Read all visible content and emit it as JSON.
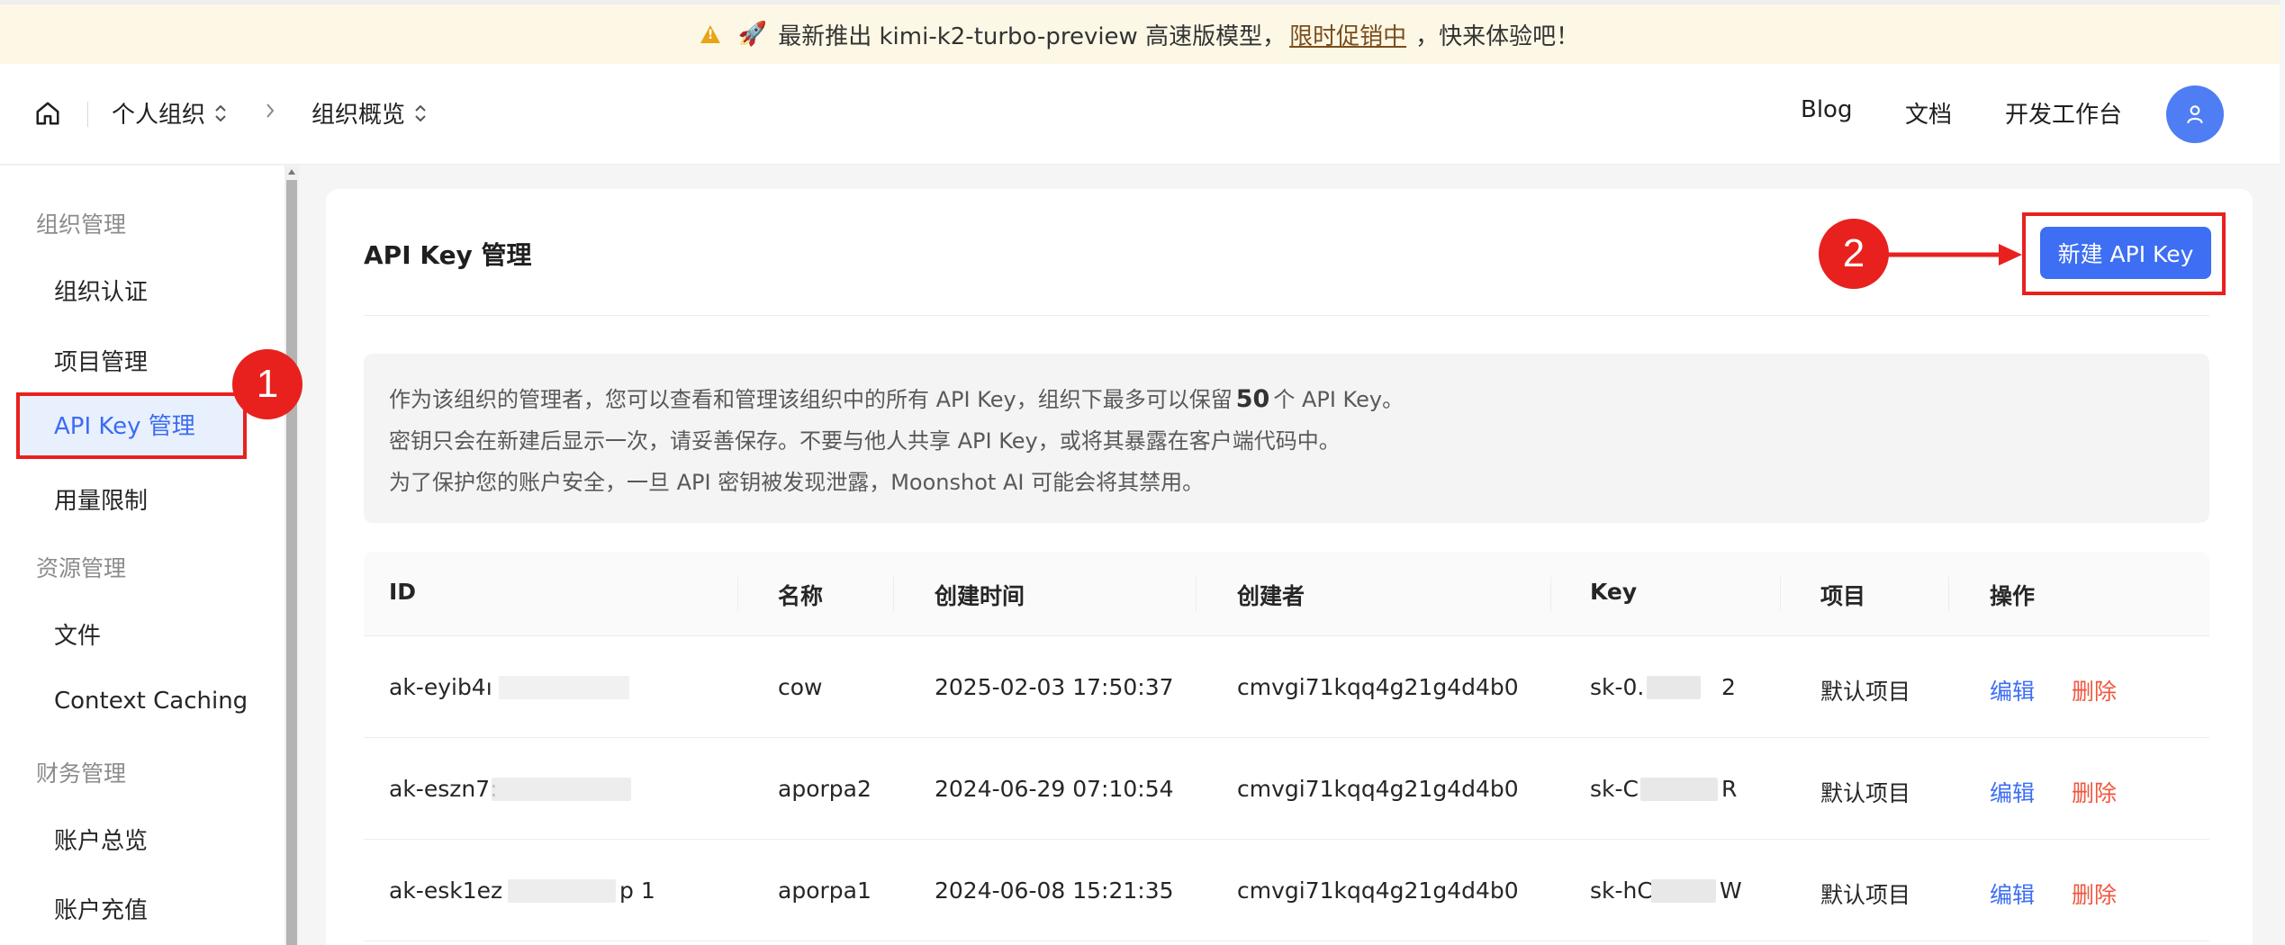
{
  "banner": {
    "text_before": "最新推出 kimi-k2-turbo-preview 高速版模型，",
    "promo_link": "限时促销中",
    "text_after": "，快来体验吧！"
  },
  "header": {
    "org_switcher": "个人组织",
    "page_switcher": "组织概览",
    "nav": [
      "Blog",
      "文档",
      "开发工作台"
    ]
  },
  "sidebar": {
    "groups": [
      {
        "title": "组织管理",
        "items": [
          "组织认证",
          "项目管理",
          "API Key 管理",
          "用量限制"
        ]
      },
      {
        "title": "资源管理",
        "items": [
          "文件",
          "Context Caching"
        ]
      },
      {
        "title": "财务管理",
        "items": [
          "账户总览",
          "账户充值"
        ]
      }
    ],
    "active_item": "API Key 管理"
  },
  "main": {
    "title": "API Key 管理",
    "new_button": "新建 API Key",
    "notice": {
      "line1_before": "作为该组织的管理者，您可以查看和管理该组织中的所有 API Key，组织下最多可以保留",
      "line1_number": "50",
      "line1_after": "个 API Key。",
      "line2": "密钥只会在新建后显示一次，请妥善保存。不要与他人共享 API Key，或将其暴露在客户端代码中。",
      "line3": "为了保护您的账户安全，一旦 API 密钥被发现泄露，Moonshot AI 可能会将其禁用。"
    },
    "table": {
      "headers": [
        "ID",
        "名称",
        "创建时间",
        "创建者",
        "Key",
        "项目",
        "操作"
      ],
      "rows": [
        {
          "id": "ak-eyib4ı",
          "name": "cow",
          "created": "2025-02-03 17:50:37",
          "creator": "cmvgi71kqq4g21g4d4b0",
          "key": "sk-0.",
          "key_tail": "2",
          "project": "默认项目",
          "edit": "编辑",
          "delete": "删除"
        },
        {
          "id": "ak-eszn7:",
          "name": "aporpa2",
          "created": "2024-06-29 07:10:54",
          "creator": "cmvgi71kqq4g21g4d4b0",
          "key": "sk-C",
          "key_tail": "R",
          "project": "默认项目",
          "edit": "编辑",
          "delete": "删除"
        },
        {
          "id": "ak-esk1ez",
          "name": "aporpa1",
          "created": "2024-06-08 15:21:35",
          "creator": "cmvgi71kqq4g21g4d4b0",
          "key": "sk-hC",
          "key_tail": "W",
          "project": "默认项目",
          "edit": "编辑",
          "delete": "删除"
        }
      ],
      "id_tail_row3": "p      1"
    }
  },
  "annotations": {
    "badge1": "1",
    "badge2": "2",
    "color": "#e8211e"
  },
  "colors": {
    "accent": "#3d6ef3",
    "danger": "#f0563e",
    "banner_bg": "#fdf8e6"
  }
}
